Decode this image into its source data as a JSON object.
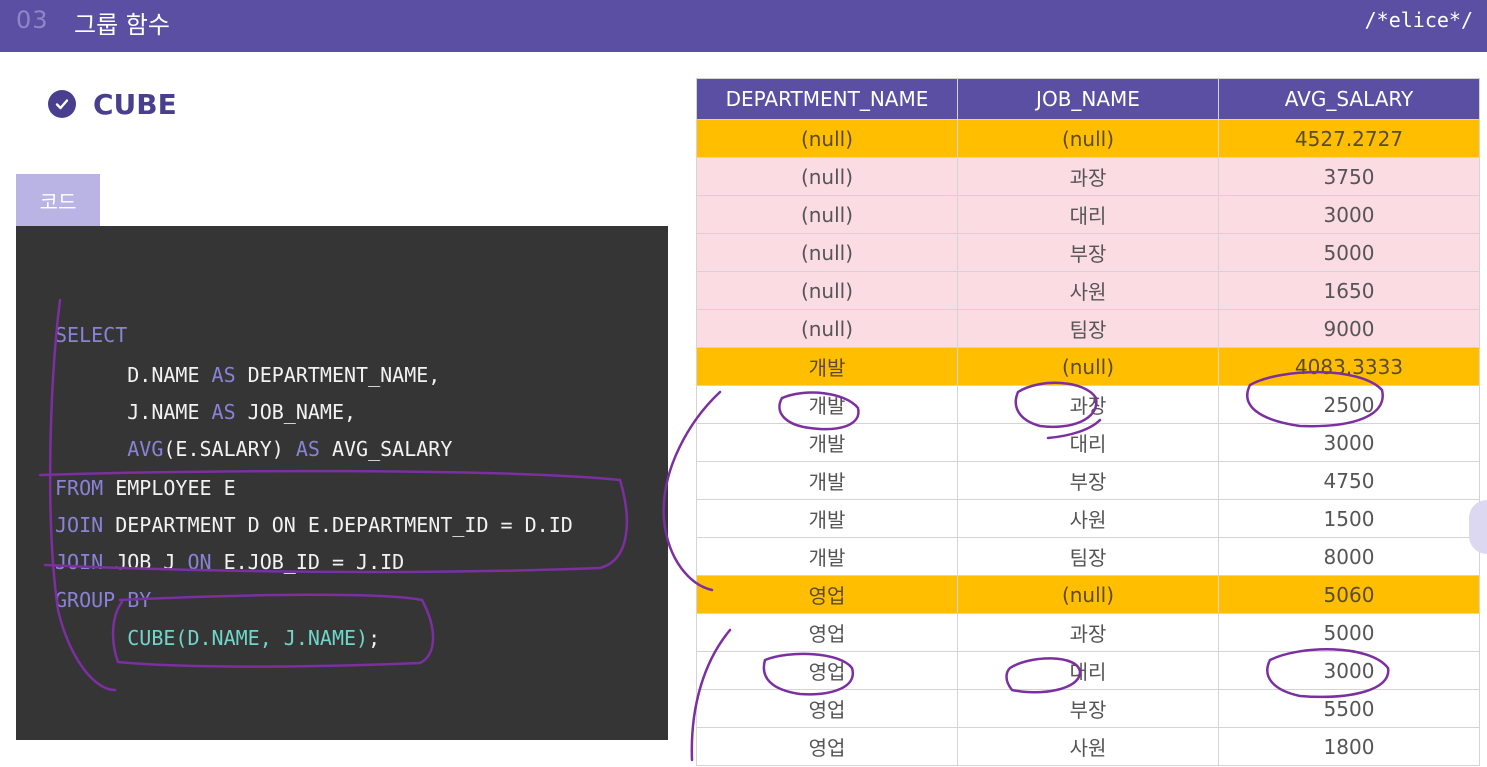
{
  "header": {
    "section_number": "03",
    "section_title": "그룹 함수",
    "brand": "/*elice*/"
  },
  "heading": {
    "title": "CUBE",
    "icon": "check-circle-icon"
  },
  "code_tab": {
    "label": "코드"
  },
  "code": {
    "lines": [
      [
        {
          "t": "SELECT",
          "k": "kw"
        }
      ],
      [
        {
          "t": "      D.NAME ",
          "k": "plain"
        },
        {
          "t": "AS",
          "k": "kw"
        },
        {
          "t": " DEPARTMENT_NAME,",
          "k": "plain"
        }
      ],
      [
        {
          "t": "      J.NAME ",
          "k": "plain"
        },
        {
          "t": "AS",
          "k": "kw"
        },
        {
          "t": " JOB_NAME,",
          "k": "plain"
        }
      ],
      [
        {
          "t": "      ",
          "k": "plain"
        },
        {
          "t": "AVG",
          "k": "kw"
        },
        {
          "t": "(E.SALARY) ",
          "k": "plain"
        },
        {
          "t": "AS",
          "k": "kw"
        },
        {
          "t": " AVG_SALARY",
          "k": "plain"
        }
      ],
      [
        {
          "t": "FROM",
          "k": "kw"
        },
        {
          "t": " EMPLOYEE E",
          "k": "plain"
        }
      ],
      [
        {
          "t": "JOIN",
          "k": "kw"
        },
        {
          "t": " DEPARTMENT D ON E.DEPARTMENT_ID = D.ID",
          "k": "plain"
        }
      ],
      [
        {
          "t": "JOIN",
          "k": "kw"
        },
        {
          "t": " JOB J ",
          "k": "plain"
        },
        {
          "t": "ON",
          "k": "kw"
        },
        {
          "t": " E.JOB_ID = J.ID",
          "k": "plain"
        }
      ],
      [
        {
          "t": "GROUP BY",
          "k": "kw"
        }
      ],
      [
        {
          "t": "      ",
          "k": "plain"
        },
        {
          "t": "CUBE(D.NAME, J.NAME)",
          "k": "fn"
        },
        {
          "t": ";",
          "k": "plain"
        }
      ]
    ]
  },
  "table": {
    "columns": [
      "DEPARTMENT_NAME",
      "JOB_NAME",
      "AVG_SALARY"
    ],
    "rows": [
      {
        "type": "total",
        "cells": [
          "(null)",
          "(null)",
          "4527.2727"
        ]
      },
      {
        "type": "job",
        "cells": [
          "(null)",
          "과장",
          "3750"
        ]
      },
      {
        "type": "job",
        "cells": [
          "(null)",
          "대리",
          "3000"
        ]
      },
      {
        "type": "job",
        "cells": [
          "(null)",
          "부장",
          "5000"
        ]
      },
      {
        "type": "job",
        "cells": [
          "(null)",
          "사원",
          "1650"
        ]
      },
      {
        "type": "job",
        "cells": [
          "(null)",
          "팀장",
          "9000"
        ]
      },
      {
        "type": "total",
        "cells": [
          "개발",
          "(null)",
          "4083.3333"
        ]
      },
      {
        "type": "plain",
        "cells": [
          "개발",
          "과장",
          "2500"
        ]
      },
      {
        "type": "plain",
        "cells": [
          "개발",
          "대리",
          "3000"
        ]
      },
      {
        "type": "plain",
        "cells": [
          "개발",
          "부장",
          "4750"
        ]
      },
      {
        "type": "plain",
        "cells": [
          "개발",
          "사원",
          "1500"
        ]
      },
      {
        "type": "plain",
        "cells": [
          "개발",
          "팀장",
          "8000"
        ]
      },
      {
        "type": "total",
        "cells": [
          "영업",
          "(null)",
          "5060"
        ]
      },
      {
        "type": "plain",
        "cells": [
          "영업",
          "과장",
          "5000"
        ]
      },
      {
        "type": "plain",
        "cells": [
          "영업",
          "대리",
          "3000"
        ]
      },
      {
        "type": "plain",
        "cells": [
          "영업",
          "부장",
          "5500"
        ]
      },
      {
        "type": "plain",
        "cells": [
          "영업",
          "사원",
          "1800"
        ]
      }
    ]
  },
  "colors": {
    "header_bg": "#5a4fa3",
    "total_row": "#ffbf00",
    "job_row": "#fcdce3",
    "code_bg": "#353535",
    "keyword": "#8a82d6",
    "function": "#6fd6c9",
    "annotation_ink": "#7b2fa0"
  }
}
